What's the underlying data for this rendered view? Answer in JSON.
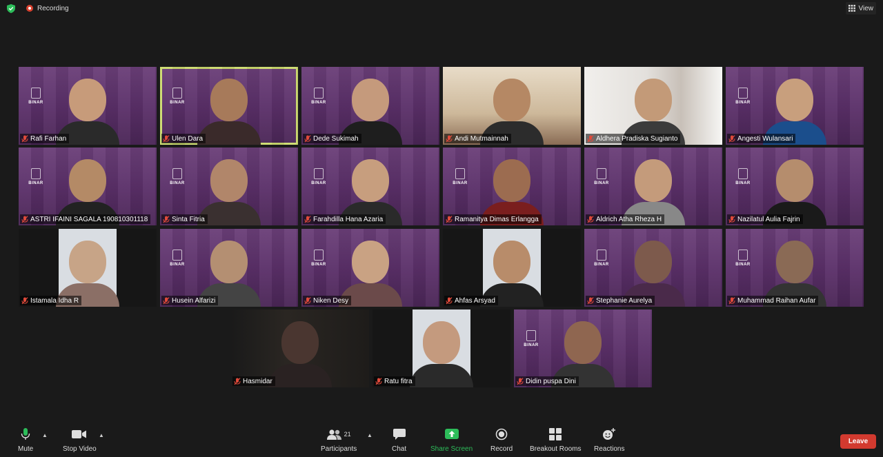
{
  "topbar": {
    "recording_label": "Recording",
    "view_label": "View"
  },
  "participants": [
    {
      "name": "Rafi Farhan",
      "skin": "#c79b7a",
      "shirt": "#2a2a2a",
      "bg": "purple"
    },
    {
      "name": "Ulen Dara",
      "skin": "#a77a5a",
      "shirt": "#3a2a2a",
      "bg": "purple",
      "active": true
    },
    {
      "name": "Dede Sukimah",
      "skin": "#c59a7c",
      "shirt": "#1e1e1e",
      "bg": "purple"
    },
    {
      "name": "Andi Mutmainnah",
      "skin": "#b58864",
      "shirt": "#2c2c2c",
      "bg": "room-beige"
    },
    {
      "name": "Aldhera Pradiska Sugianto",
      "skin": "#c39a78",
      "shirt": "#3b3b3b",
      "bg": "room-white"
    },
    {
      "name": "Angesti Wulansari",
      "skin": "#c89f7d",
      "shirt": "#1b4e8c",
      "bg": "purple"
    },
    {
      "name": "ASTRI IFAINI SAGALA 190810301118",
      "skin": "#b48a66",
      "shirt": "#222",
      "bg": "purple"
    },
    {
      "name": "Sinta Fitria",
      "skin": "#b1866a",
      "shirt": "#3a3030",
      "bg": "purple"
    },
    {
      "name": "Farahdilla Hana Azaria",
      "skin": "#c79e7e",
      "shirt": "#2a2a2a",
      "bg": "purple"
    },
    {
      "name": "Ramanitya Dimas Erlangga",
      "skin": "#9c6c50",
      "shirt": "#7a1e1e",
      "bg": "purple"
    },
    {
      "name": "Aldrich Atha Rheza H",
      "skin": "#c49b7b",
      "shirt": "#888",
      "bg": "purple"
    },
    {
      "name": "Nazilatul Aulia Fajrin",
      "skin": "#b58d6d",
      "shirt": "#1a1a1a",
      "bg": "purple"
    },
    {
      "name": "Istamala Idha R",
      "skin": "#c7a487",
      "shirt": "#8b6f66",
      "bg": "dark-white"
    },
    {
      "name": "Husein Alfarizi",
      "skin": "#b48f72",
      "shirt": "#444",
      "bg": "purple"
    },
    {
      "name": "Niken Desy",
      "skin": "#c9a283",
      "shirt": "#6b4a4a",
      "bg": "purple"
    },
    {
      "name": "Ahfas Arsyad",
      "skin": "#b88c6a",
      "shirt": "#222",
      "bg": "dark-white"
    },
    {
      "name": "Stephanie Aurelya",
      "skin": "#7d5a4c",
      "shirt": "#4a2a4a",
      "bg": "purple"
    },
    {
      "name": "Muhammad Raihan Aufar",
      "skin": "#8a6a55",
      "shirt": "#333",
      "bg": "purple"
    },
    {
      "name": "Hasmidar",
      "skin": "#4a3630",
      "shirt": "#2a2222",
      "bg": "dark"
    },
    {
      "name": "Ratu fitra",
      "skin": "#c49a7e",
      "shirt": "#2a2a2a",
      "bg": "dark-white"
    },
    {
      "name": "Didin puspa Dini",
      "skin": "#8f6650",
      "shirt": "#333",
      "bg": "purple"
    }
  ],
  "toolbar": {
    "mute_label": "Mute",
    "stop_video_label": "Stop Video",
    "participants_label": "Participants",
    "participants_count": "21",
    "chat_label": "Chat",
    "share_screen_label": "Share Screen",
    "record_label": "Record",
    "breakout_rooms_label": "Breakout Rooms",
    "reactions_label": "Reactions",
    "leave_label": "Leave"
  },
  "colors": {
    "accent_green": "#2dbd5a",
    "leave_red": "#d23a2f",
    "active_speaker": "#cddc6f"
  }
}
